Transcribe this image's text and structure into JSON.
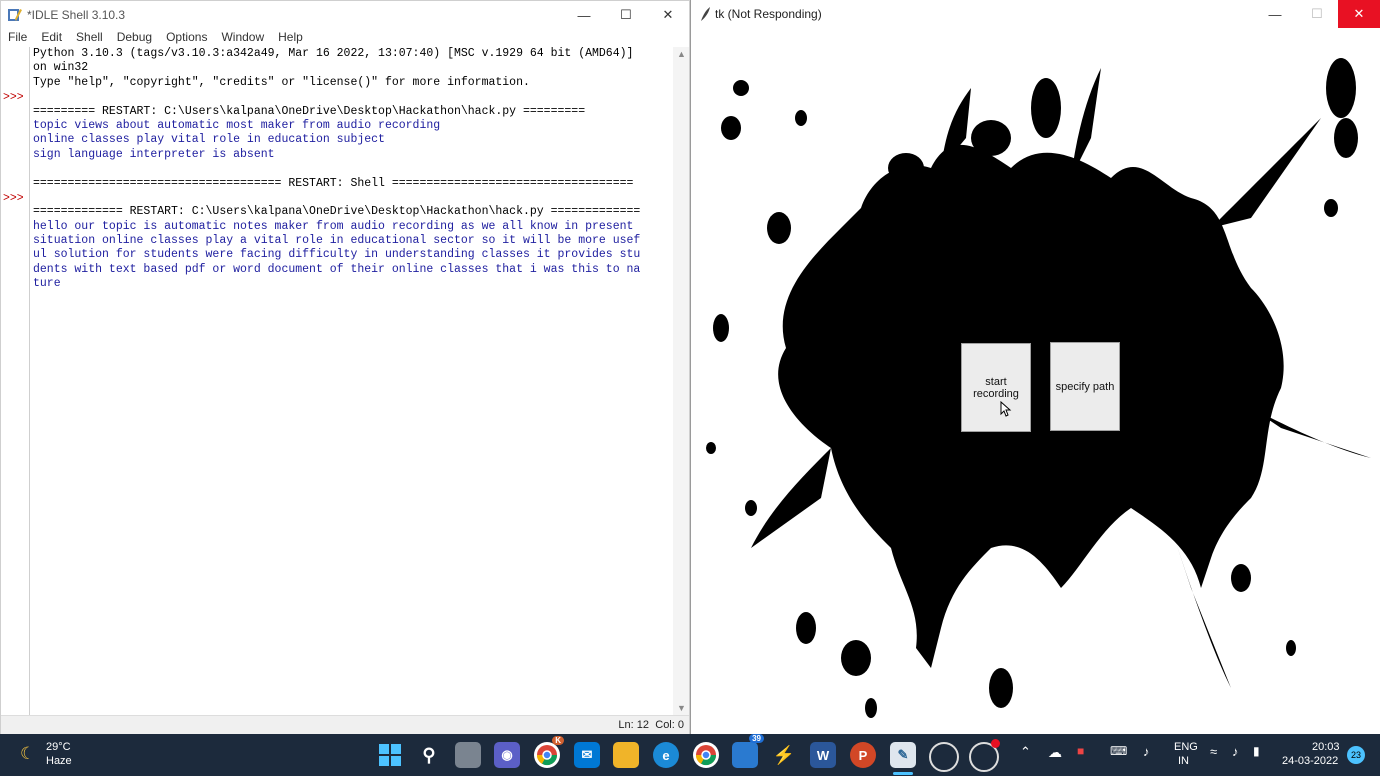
{
  "idle": {
    "title": "*IDLE Shell 3.10.3",
    "menu": [
      "File",
      "Edit",
      "Shell",
      "Debug",
      "Options",
      "Window",
      "Help"
    ],
    "prompts": [
      ">>>",
      ">>>"
    ],
    "lines": [
      {
        "t": "Python 3.10.3 (tags/v3.10.3:a342a49, Mar 16 2022, 13:07:40) [MSC v.1929 64 bit (AMD64)]",
        "c": "std"
      },
      {
        "t": "on win32",
        "c": "std"
      },
      {
        "t": "Type \"help\", \"copyright\", \"credits\" or \"license()\" for more information.",
        "c": "std"
      },
      {
        "t": "",
        "c": "std"
      },
      {
        "t": "========= RESTART: C:\\Users\\kalpana\\OneDrive\\Desktop\\Hackathon\\hack.py =========",
        "c": "std"
      },
      {
        "t": "topic views about automatic most maker from audio recording",
        "c": "out"
      },
      {
        "t": "online classes play vital role in education subject",
        "c": "out"
      },
      {
        "t": "sign language interpreter is absent",
        "c": "out"
      },
      {
        "t": "",
        "c": "std"
      },
      {
        "t": "==================================== RESTART: Shell ===================================",
        "c": "std"
      },
      {
        "t": "",
        "c": "std"
      },
      {
        "t": "============= RESTART: C:\\Users\\kalpana\\OneDrive\\Desktop\\Hackathon\\hack.py =============",
        "c": "std"
      },
      {
        "t": "hello our topic is automatic notes maker from audio recording as we all know in present",
        "c": "out"
      },
      {
        "t": "situation online classes play a vital role in educational sector so it will be more usef",
        "c": "out"
      },
      {
        "t": "ul solution for students were facing difficulty in understanding classes it provides stu",
        "c": "out"
      },
      {
        "t": "dents with text based pdf or word document of their online classes that i was this to na",
        "c": "out"
      },
      {
        "t": "ture",
        "c": "out"
      }
    ],
    "status": {
      "ln": "Ln: 12",
      "col": "Col: 0"
    }
  },
  "tk": {
    "title": "tk (Not Responding)",
    "buttons": {
      "start": "start recording",
      "path": "specify path"
    }
  },
  "taskbar": {
    "weather": {
      "temp": "29°C",
      "cond": "Haze"
    },
    "badges": {
      "chrome": "K",
      "tasks": "39",
      "notif": "23"
    },
    "lang": {
      "l1": "ENG",
      "l2": "IN"
    },
    "time": "20:03",
    "date": "24-03-2022"
  },
  "colors": {
    "taskbar": "#1c2a3c",
    "output": "#2020a0",
    "prompt": "#c00000",
    "close": "#e81123"
  }
}
